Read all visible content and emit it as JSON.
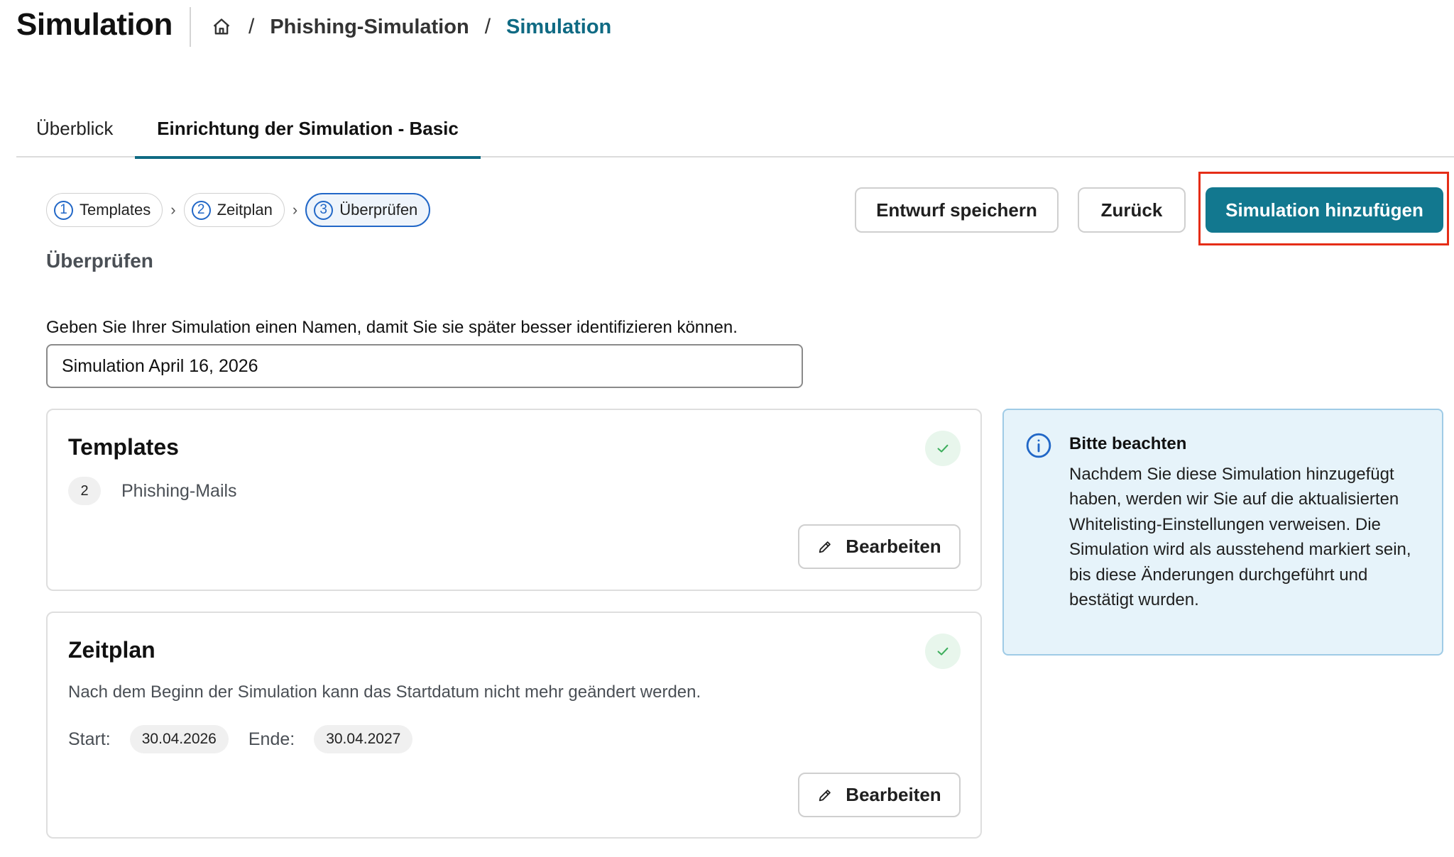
{
  "header": {
    "title": "Simulation",
    "breadcrumbs": [
      "Phishing-Simulation",
      "Simulation"
    ]
  },
  "tabs": [
    {
      "label": "Überblick",
      "active": false
    },
    {
      "label": "Einrichtung der Simulation - Basic",
      "active": true
    }
  ],
  "stepper": [
    {
      "number": "1",
      "label": "Templates",
      "active": false
    },
    {
      "number": "2",
      "label": "Zeitplan",
      "active": false
    },
    {
      "number": "3",
      "label": "Überprüfen",
      "active": true
    }
  ],
  "actions": {
    "save_draft": "Entwurf speichern",
    "back": "Zurück",
    "add_simulation": "Simulation hinzufügen"
  },
  "section_title": "Überprüfen",
  "name_field": {
    "label": "Geben Sie Ihrer Simulation einen Namen, damit Sie sie später besser identifizieren können.",
    "value": "Simulation April 16, 2026"
  },
  "templates_card": {
    "title": "Templates",
    "count": "2",
    "count_label": "Phishing-Mails",
    "edit_label": "Bearbeiten"
  },
  "schedule_card": {
    "title": "Zeitplan",
    "note": "Nach dem Beginn der Simulation kann das Startdatum nicht mehr geändert werden.",
    "start_label": "Start:",
    "start_value": "30.04.2026",
    "end_label": "Ende:",
    "end_value": "30.04.2027",
    "edit_label": "Bearbeiten"
  },
  "info": {
    "title": "Bitte beachten",
    "body": "Nachdem Sie diese Simulation hinzugefügt haben, werden wir Sie auf die aktualisierten Whitelisting-Einstellungen verweisen. Die Simulation wird als ausstehend markiert sein, bis diese Änderungen durchgeführt und bestätigt wurden."
  },
  "colors": {
    "accent": "#12788f",
    "breadcrumb_current": "#0f6a83",
    "step_active": "#2167c7",
    "info_bg": "#e6f3fa",
    "success_check": "#3dae5c",
    "highlight": "#e52d17"
  },
  "icons": [
    "home-icon",
    "chevron-right-icon",
    "check-icon",
    "pencil-icon",
    "info-icon"
  ]
}
